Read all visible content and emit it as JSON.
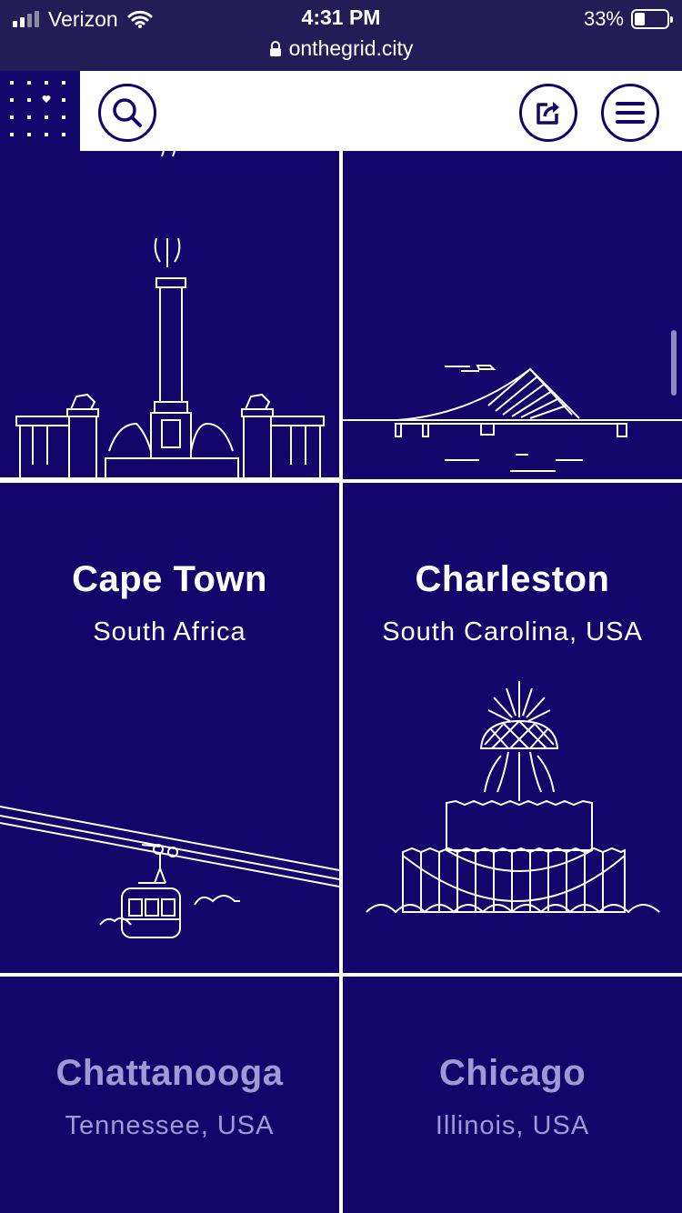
{
  "status_bar": {
    "carrier": "Verizon",
    "time": "4:31 PM",
    "battery": "33%",
    "url": "onthegrid.city"
  },
  "nav": {
    "search_icon": "search-icon",
    "share_icon": "share-icon",
    "menu_icon": "menu-icon"
  },
  "cities": [
    {
      "name": "Cape Town",
      "region": "South Africa",
      "illustration": "cable-car-icon"
    },
    {
      "name": "Charleston",
      "region": "South Carolina, USA",
      "illustration": "pineapple-fountain-icon"
    },
    {
      "name": "Chattanooga",
      "region": "Tennessee, USA"
    },
    {
      "name": "Chicago",
      "region": "Illinois, USA"
    }
  ],
  "colors": {
    "background": "#13066b",
    "statusbar": "#221d56",
    "faded_text": "#9f99d4"
  }
}
